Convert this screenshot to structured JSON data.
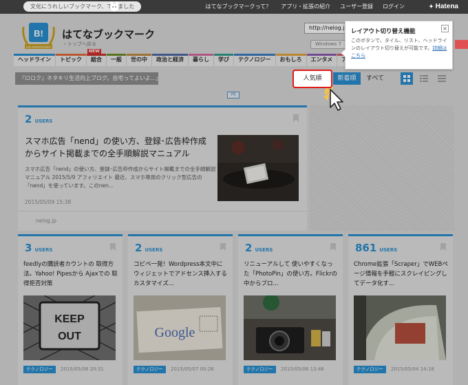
{
  "topbar": {
    "tagline": "文化にうれしいブックマーク、できました",
    "links": [
      "はてなブックマークって？",
      "アプリ・拡張の紹介",
      "ユーザー登録",
      "ログイン"
    ],
    "logo": "Hatena"
  },
  "header": {
    "title": "はてなブックマーク",
    "badge_text": "B!",
    "badge_caption": "10th ANNIVERSARY",
    "back_link": "トップへ戻る",
    "url_value": "http://nelog.jp/",
    "os_chip": "Windows 7"
  },
  "nav": {
    "items": [
      {
        "label": "ヘッドライン",
        "color": "#2a8fd0"
      },
      {
        "label": "トピック",
        "color": "#e56b3a",
        "badge": "NEW"
      },
      {
        "label": "総合",
        "color": "#c9302c"
      },
      {
        "label": "一般",
        "color": "#6b8e23"
      },
      {
        "label": "世の中",
        "color": "#c08a3e"
      },
      {
        "label": "政治と経済",
        "color": "#4e6aa5"
      },
      {
        "label": "暮らし",
        "color": "#d36aa0"
      },
      {
        "label": "学び",
        "color": "#2f9e8b"
      },
      {
        "label": "テクノロジー",
        "color": "#3b7dc4"
      },
      {
        "label": "おもしろ",
        "color": "#e3a53a"
      },
      {
        "label": "エンタメ",
        "color": "#8d5bb2"
      },
      {
        "label": "アニメとゲ",
        "color": "#d65b5b"
      }
    ]
  },
  "sort": {
    "breadcrumb": "『ロロク』ネタキリ生活向上ブログ。自宅ってよいよ...」",
    "popular": "人気順",
    "newest": "新着順",
    "all": "すべて"
  },
  "pr_label": "PR",
  "tooltip": {
    "title": "レイアウト切り替え機能",
    "body": "このボタンで、タイル、リスト、ヘッドラインのレイアウト切り替えが可能です。",
    "link": "詳細はこちら",
    "close": "×"
  },
  "featured": {
    "users_count": "2",
    "users_label": "USERS",
    "title": "スマホ広告「nend」の使い方、登録･広告枠作成からサイト掲載までの全手順解説マニュアル",
    "description": "スマホ広告「nend」の使い方、登録･広告枠作成からサイト掲載までの全手順解説マニュアル 2015/5/9 アフィリエイト 最近、スマホ専用のクリック型広告の「nend」を使っています。このnen...",
    "date": "2015/05/09 15:38",
    "domain": "nelog.jp"
  },
  "cards": [
    {
      "users_count": "3",
      "users_label": "USERS",
      "title": "feedlyの購読者カウントの 取得方法。Yahoo! Pipesから Ajaxでの 取得拒否対策",
      "tag": "テクノロジー",
      "date": "2015/05/08 20:31",
      "photo_text": "KEEP OUT"
    },
    {
      "users_count": "2",
      "users_label": "USERS",
      "title": "コピペ一発！Wordpress本文中にウィジェットでアドセンス挿入するカスタマイズ...",
      "tag": "テクノロジー",
      "date": "2015/05/07 00:26",
      "photo_text": "Google"
    },
    {
      "users_count": "2",
      "users_label": "USERS",
      "title": "リニューアルして 使いやすくなった「PhotoPin」の使い方。Flickrの 中からブロ...",
      "tag": "テクノロジー",
      "date": "2015/05/06 13:46",
      "photo_text": ""
    },
    {
      "users_count": "861",
      "users_label": "USERS",
      "title": "Chrome拡張「Scraper」でWEBページ情報を手軽にスクレイピングしてデータ化す...",
      "tag": "テクノロジー",
      "date": "2015/05/04 14:18",
      "photo_text": ""
    }
  ]
}
